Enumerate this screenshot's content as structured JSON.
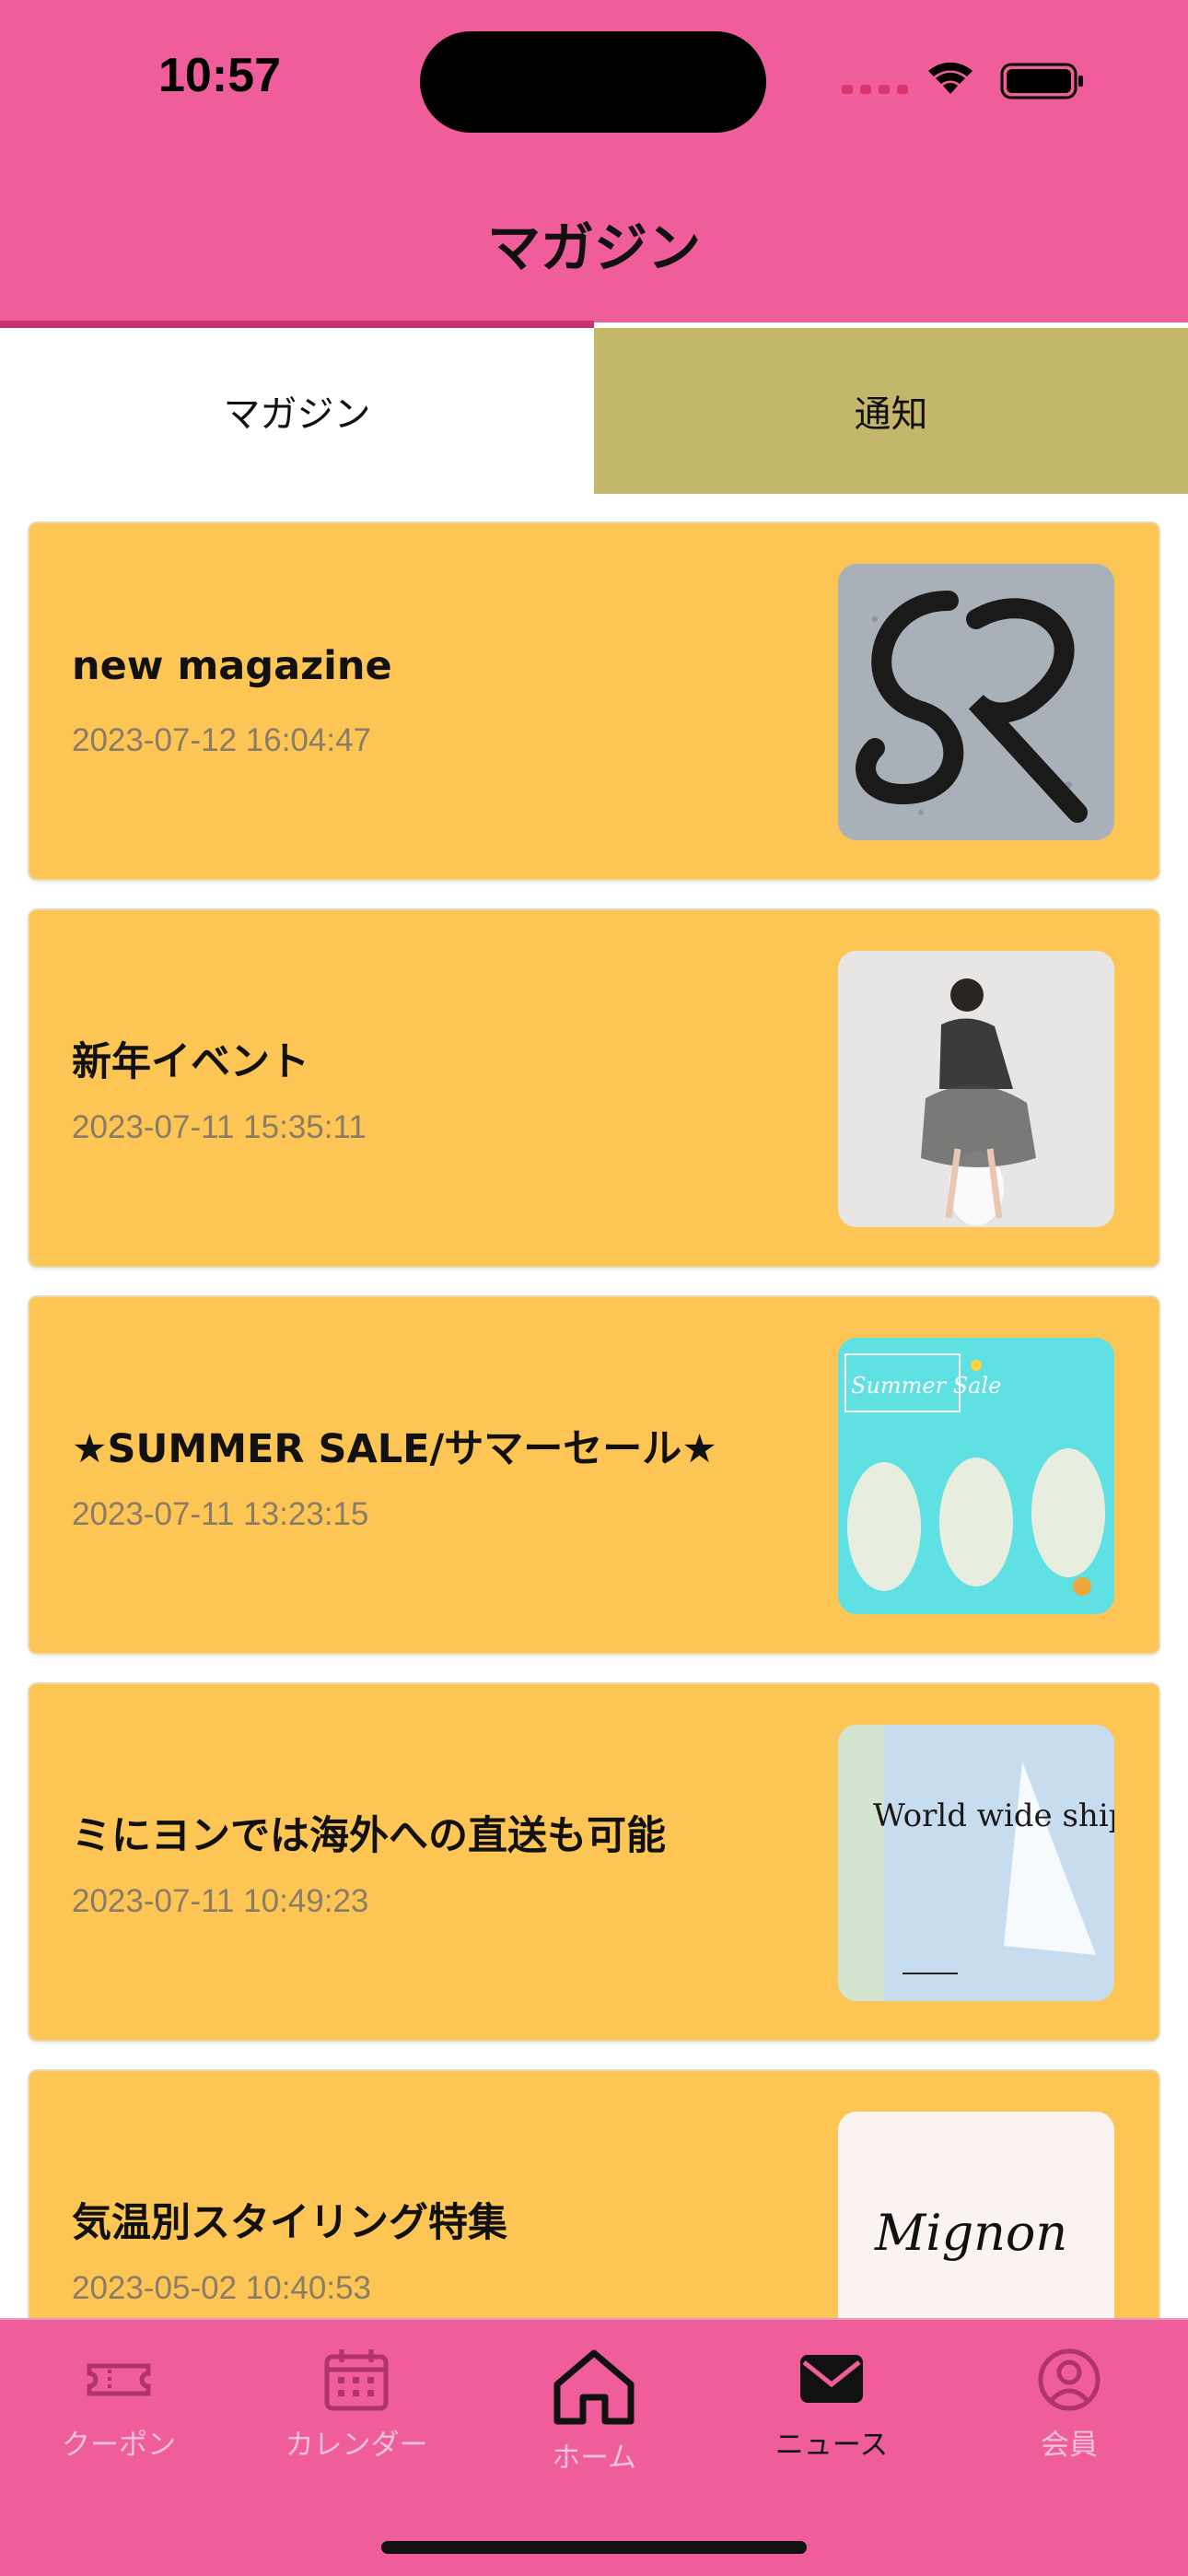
{
  "status_bar": {
    "time": "10:57"
  },
  "header": {
    "title": "マガジン"
  },
  "tabs": [
    {
      "label": "マガジン",
      "selected": true
    },
    {
      "label": "通知",
      "selected": false
    }
  ],
  "articles": [
    {
      "title": "new magazine",
      "date": "2023-07-12 16:04:47",
      "thumb_text": "SR"
    },
    {
      "title": "新年イベント",
      "date": "2023-07-11 15:35:11",
      "thumb_text": ""
    },
    {
      "title": "★SUMMER SALE/サマーセール★",
      "date": "2023-07-11 13:23:15",
      "thumb_text": "Summer Sale"
    },
    {
      "title": "ミにヨンでは海外への直送も可能",
      "date": "2023-07-11 10:49:23",
      "thumb_text": "World wide shipping"
    },
    {
      "title": "気温別スタイリング特集",
      "date": "2023-05-02 10:40:53",
      "thumb_text": "Mignon"
    }
  ],
  "tab_bar": [
    {
      "label": "クーポン",
      "icon": "ticket-icon",
      "active": false
    },
    {
      "label": "カレンダー",
      "icon": "calendar-icon",
      "active": false
    },
    {
      "label": "ホーム",
      "icon": "home-icon",
      "active": false
    },
    {
      "label": "ニュース",
      "icon": "envelope-icon",
      "active": true
    },
    {
      "label": "会員",
      "icon": "person-icon",
      "active": false
    }
  ],
  "colors": {
    "header": "#ef5e9a",
    "card": "#fdc553",
    "notice_tab": "#c4b66a",
    "tab_indicator": "#c9326e"
  }
}
